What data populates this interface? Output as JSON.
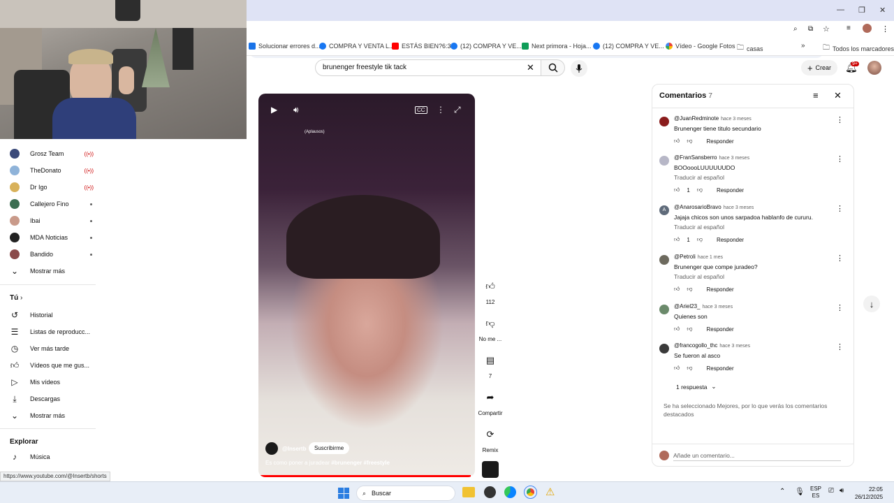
{
  "bookmarks": [
    {
      "label": "Solucionar errores d...",
      "icon": "page-icon",
      "color": "#1a73e8"
    },
    {
      "label": "COMPRA Y VENTA L...",
      "icon": "facebook-icon",
      "color": "#1877f2"
    },
    {
      "label": "ESTÁS BIEN?6:33",
      "icon": "youtube-icon",
      "color": "#ff0000"
    },
    {
      "label": "(12) COMPRA Y VE...",
      "icon": "facebook-icon",
      "color": "#1877f2"
    },
    {
      "label": "Next primora - Hoja...",
      "icon": "sheets-icon",
      "color": "#0f9d58"
    },
    {
      "label": "(12) COMPRA Y VE...",
      "icon": "facebook-icon",
      "color": "#1877f2"
    },
    {
      "label": "Vídeo - Google Fotos",
      "icon": "photos-icon",
      "color": "#fbbc04"
    },
    {
      "label": "casas",
      "icon": "folder-icon",
      "color": "#5f6368"
    }
  ],
  "all_bookmarks": "Todos los marcadores",
  "search": {
    "query": "brunenger freestyle tik tack"
  },
  "header": {
    "create_label": "Crear",
    "notifications_badge": "9+"
  },
  "sidebar": {
    "subscriptions": [
      {
        "name": "Grosz Team",
        "status": "live",
        "color": "#3b4a7a"
      },
      {
        "name": "TheDonato",
        "status": "live",
        "color": "#8fb3d9"
      },
      {
        "name": "Dr Igo",
        "status": "live",
        "color": "#d8b15a"
      },
      {
        "name": "Callejero Fino",
        "status": "new",
        "color": "#3c6e52"
      },
      {
        "name": "Ibai",
        "status": "new",
        "color": "#c99a8a"
      },
      {
        "name": "MDA Noticias",
        "status": "new",
        "color": "#222222"
      },
      {
        "name": "Bandido",
        "status": "new",
        "color": "#8a4a4a"
      }
    ],
    "show_more_subs": "Mostrar más",
    "you_heading": "Tú",
    "you_items": [
      {
        "label": "Historial",
        "icon": "history-icon",
        "glyph": "↺"
      },
      {
        "label": "Listas de reproducc...",
        "icon": "playlist-icon",
        "glyph": "☰"
      },
      {
        "label": "Ver más tarde",
        "icon": "clock-icon",
        "glyph": "◷"
      },
      {
        "label": "Vídeos que me gus...",
        "icon": "thumbs-up-icon",
        "glyph": "👍"
      },
      {
        "label": "Mis vídeos",
        "icon": "my-videos-icon",
        "glyph": "▶"
      },
      {
        "label": "Descargas",
        "icon": "download-icon",
        "glyph": "⤓"
      }
    ],
    "show_more_you": "Mostrar más",
    "explore_heading": "Explorar",
    "explore_items": [
      {
        "label": "Música",
        "icon": "music-icon",
        "glyph": "♪"
      }
    ]
  },
  "video": {
    "tag": "(Aplausos)",
    "channel": "@Insertb",
    "subscribe_label": "Suscribirme",
    "description": "Es como poner a juradear",
    "hashtags": "#brunenger  #freestyle",
    "progress": 0.98
  },
  "actions": {
    "likes": "112",
    "dislike_label": "No me ...",
    "comments_count": "7",
    "share_label": "Compartir",
    "remix_label": "Remix"
  },
  "comments": {
    "title": "Comentarios",
    "count": "7",
    "items": [
      {
        "author": "@JuanRedminote",
        "time": "hace 3 meses",
        "text": "Brunenger tiene titulo secundario",
        "translate": "",
        "likes": "",
        "avatar_color": "#8a1c1c"
      },
      {
        "author": "@FranSansberro",
        "time": "hace 3 meses",
        "text": "BOOoooLUUUUUUDO",
        "translate": "Traducir al español",
        "likes": "1",
        "avatar_color": "#b7b7c7"
      },
      {
        "author": "@AnarosarioBravo",
        "time": "hace 3 meses",
        "text": "Jajaja chicos son unos sarpadoa hablanfo de cururu.",
        "translate": "Traducir al español",
        "likes": "1",
        "avatar_color": "#5f6b7a"
      },
      {
        "author": "@Petroli",
        "time": "hace 1 mes",
        "text": "Brunenger que compe juradeo?",
        "translate": "Traducir al español",
        "likes": "",
        "avatar_color": "#6d6a5e"
      },
      {
        "author": "@Ariel23_",
        "time": "hace 3 meses",
        "text": "Quienes son",
        "translate": "",
        "likes": "",
        "avatar_color": "#6b8a6b"
      },
      {
        "author": "@francogollo_thc",
        "time": "hace 3 meses",
        "text": "Se fueron al asco",
        "translate": "",
        "likes": "",
        "avatar_color": "#3a3a3a"
      }
    ],
    "reply_label": "Responder",
    "replies_label": "1 respuesta",
    "notice": "Se ha seleccionado Mejores, por lo que verás los comentarios destacados",
    "add_placeholder": "Añade un comentario..."
  },
  "status_url": "https://www.youtube.com/@Insertb/shorts",
  "taskbar": {
    "search_placeholder": "Buscar",
    "lang_top": "ESP",
    "lang_bottom": "ES",
    "time": "22:05",
    "date": "26/12/2025"
  }
}
